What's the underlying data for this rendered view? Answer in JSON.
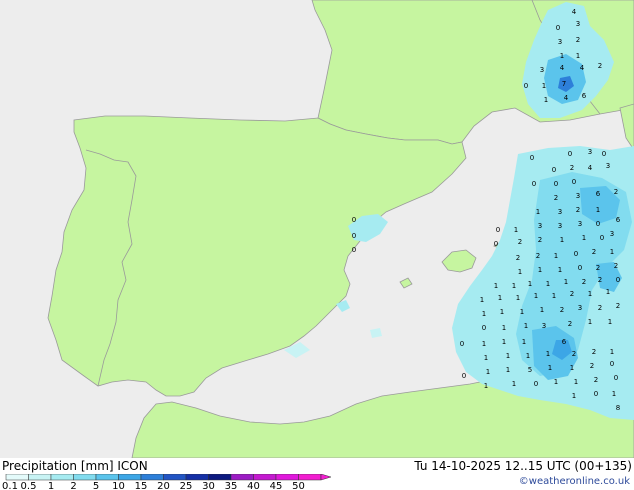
{
  "header": {
    "title": "Precipitation [mm]",
    "model": "ICON",
    "valid_time": "Tu 14-10-2025 12..15 UTC (00+135)"
  },
  "credit": "©weatheronline.co.uk",
  "legend": {
    "labels": [
      "0.1",
      "0.5",
      "1",
      "2",
      "5",
      "10",
      "15",
      "20",
      "25",
      "30",
      "35",
      "40",
      "45",
      "50"
    ],
    "colors": [
      "#e4fbfb",
      "#c8f3f4",
      "#a6ebf1",
      "#82dcef",
      "#5bc4ec",
      "#3ca6e6",
      "#2d7fd9",
      "#2255c4",
      "#1530a6",
      "#0d1a80",
      "#9c1cc4",
      "#c41ad0",
      "#e018dc",
      "#f21ed0"
    ]
  },
  "colors": {
    "sea": "#ededed",
    "land": "#c6f5a0",
    "border": "#9a9a9a"
  },
  "values": [
    {
      "t": "4"
    },
    {
      "t": "0"
    },
    {
      "t": "3"
    },
    {
      "t": "3"
    },
    {
      "t": "2"
    },
    {
      "t": "1"
    },
    {
      "t": "1"
    },
    {
      "t": "3"
    },
    {
      "t": "4"
    },
    {
      "t": "4"
    },
    {
      "t": "2"
    },
    {
      "t": "0"
    },
    {
      "t": "1"
    },
    {
      "t": "7"
    },
    {
      "t": "1"
    },
    {
      "t": "4"
    },
    {
      "t": "6"
    },
    {
      "t": "0"
    },
    {
      "t": "0"
    },
    {
      "t": "0"
    },
    {
      "t": "0"
    },
    {
      "t": "0"
    },
    {
      "t": "3"
    },
    {
      "t": "0"
    },
    {
      "t": "0"
    },
    {
      "t": "2"
    },
    {
      "t": "4"
    },
    {
      "t": "3"
    },
    {
      "t": "0"
    },
    {
      "t": "0"
    },
    {
      "t": "0"
    },
    {
      "t": "2"
    },
    {
      "t": "3"
    },
    {
      "t": "6"
    },
    {
      "t": "2"
    },
    {
      "t": "1"
    },
    {
      "t": "3"
    },
    {
      "t": "2"
    },
    {
      "t": "1"
    },
    {
      "t": "6"
    },
    {
      "t": "0"
    },
    {
      "t": "1"
    },
    {
      "t": "3"
    },
    {
      "t": "3"
    },
    {
      "t": "3"
    },
    {
      "t": "0"
    },
    {
      "t": "3"
    },
    {
      "t": "0"
    },
    {
      "t": "2"
    },
    {
      "t": "2"
    },
    {
      "t": "1"
    },
    {
      "t": "1"
    },
    {
      "t": "0"
    },
    {
      "t": "2"
    },
    {
      "t": "2"
    },
    {
      "t": "1"
    },
    {
      "t": "0"
    },
    {
      "t": "2"
    },
    {
      "t": "1"
    },
    {
      "t": "1"
    },
    {
      "t": "1"
    },
    {
      "t": "1"
    },
    {
      "t": "0"
    },
    {
      "t": "2"
    },
    {
      "t": "2"
    },
    {
      "t": "1"
    },
    {
      "t": "1"
    },
    {
      "t": "1"
    },
    {
      "t": "1"
    },
    {
      "t": "1"
    },
    {
      "t": "2"
    },
    {
      "t": "2"
    },
    {
      "t": "0"
    },
    {
      "t": "1"
    },
    {
      "t": "1"
    },
    {
      "t": "1"
    },
    {
      "t": "1"
    },
    {
      "t": "1"
    },
    {
      "t": "2"
    },
    {
      "t": "1"
    },
    {
      "t": "1"
    },
    {
      "t": "1"
    },
    {
      "t": "1"
    },
    {
      "t": "1"
    },
    {
      "t": "1"
    },
    {
      "t": "2"
    },
    {
      "t": "3"
    },
    {
      "t": "2"
    },
    {
      "t": "2"
    },
    {
      "t": "0"
    },
    {
      "t": "1"
    },
    {
      "t": "1"
    },
    {
      "t": "0"
    },
    {
      "t": "1"
    },
    {
      "t": "1"
    },
    {
      "t": "1"
    },
    {
      "t": "3"
    },
    {
      "t": "2"
    },
    {
      "t": "1"
    },
    {
      "t": "1"
    },
    {
      "t": "1"
    },
    {
      "t": "1"
    },
    {
      "t": "1"
    },
    {
      "t": "1"
    },
    {
      "t": "6"
    },
    {
      "t": "2"
    },
    {
      "t": "2"
    },
    {
      "t": "1"
    },
    {
      "t": "1"
    },
    {
      "t": "1"
    },
    {
      "t": "5"
    },
    {
      "t": "1"
    },
    {
      "t": "1"
    },
    {
      "t": "2"
    },
    {
      "t": "0"
    },
    {
      "t": "0"
    },
    {
      "t": "1"
    },
    {
      "t": "0"
    },
    {
      "t": "1"
    },
    {
      "t": "1"
    },
    {
      "t": "2"
    },
    {
      "t": "0"
    },
    {
      "t": "1"
    },
    {
      "t": "1"
    },
    {
      "t": "0"
    },
    {
      "t": "1"
    },
    {
      "t": "8"
    }
  ]
}
